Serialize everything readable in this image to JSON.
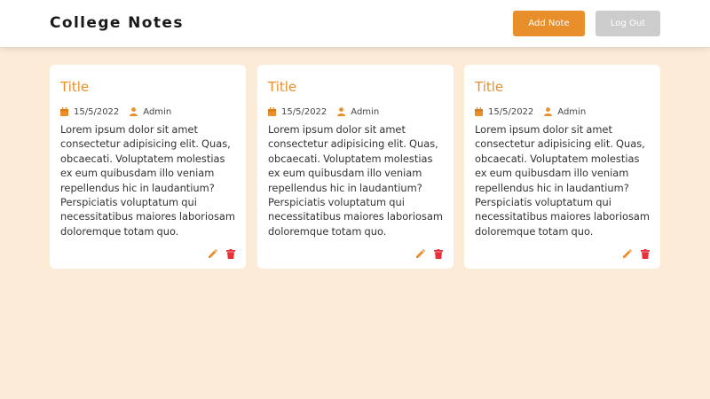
{
  "header": {
    "title": "College Notes",
    "add_note_label": "Add Note",
    "logout_label": "Log Out"
  },
  "notes": [
    {
      "title": "Title",
      "date": "15/5/2022",
      "author": "Admin",
      "body": "Lorem ipsum dolor sit amet consectetur adipisicing elit. Quas, obcaecati. Voluptatem molestias ex eum quibusdam illo veniam repellendus hic in laudantium? Perspiciatis voluptatum qui necessitatibus maiores laboriosam doloremque totam quo."
    },
    {
      "title": "Title",
      "date": "15/5/2022",
      "author": "Admin",
      "body": "Lorem ipsum dolor sit amet consectetur adipisicing elit. Quas, obcaecati. Voluptatem molestias ex eum quibusdam illo veniam repellendus hic in laudantium? Perspiciatis voluptatum qui necessitatibus maiores laboriosam doloremque totam quo."
    },
    {
      "title": "Title",
      "date": "15/5/2022",
      "author": "Admin",
      "body": "Lorem ipsum dolor sit amet consectetur adipisicing elit. Quas, obcaecati. Voluptatem molestias ex eum quibusdam illo veniam repellendus hic in laudantium? Perspiciatis voluptatum qui necessitatibus maiores laboriosam doloremque totam quo."
    }
  ],
  "icons": {
    "date": "calendar-icon",
    "author": "user-icon",
    "edit": "pencil-icon",
    "delete": "trash-icon"
  },
  "colors": {
    "background": "#fcebd7",
    "accent": "#e88f2c",
    "logout_button": "#cccccc",
    "delete_icon": "#e8303a"
  }
}
